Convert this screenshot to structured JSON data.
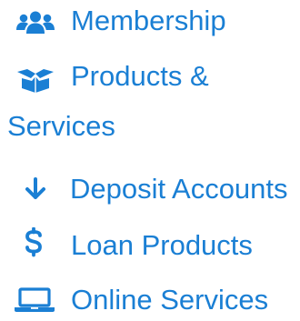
{
  "accent_color": "#1a7fd4",
  "nav": {
    "items": [
      {
        "label": "Membership",
        "icon": "users-icon"
      },
      {
        "label": "Products &",
        "label_continued": "Services",
        "icon": "box-open-icon"
      },
      {
        "label": "Deposit Accounts",
        "icon": "arrow-down-icon"
      },
      {
        "label": "Loan Products",
        "icon": "dollar-sign-icon"
      },
      {
        "label": "Online Services",
        "icon": "laptop-icon"
      }
    ]
  }
}
